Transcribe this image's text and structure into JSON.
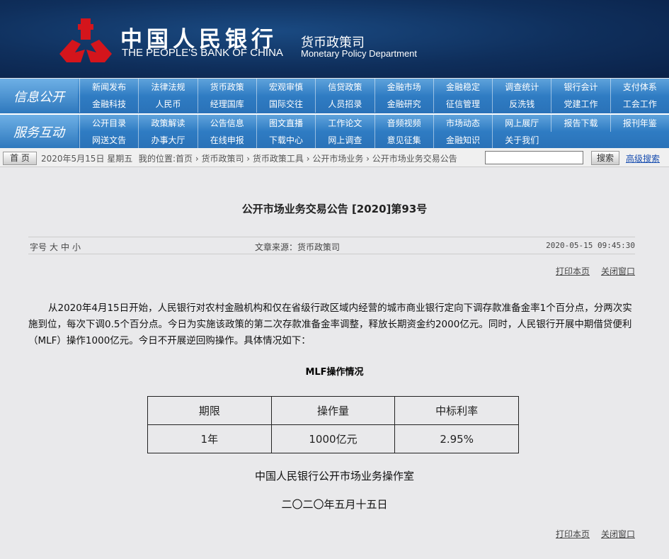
{
  "header": {
    "bank_cn": "中国人民银行",
    "bank_en": "THE PEOPLE'S BANK OF CHINA",
    "dept_cn": "货币政策司",
    "dept_en": "Monetary Policy Department"
  },
  "nav": {
    "band1_label": "信息公开",
    "band1_items": [
      "新闻发布",
      "法律法规",
      "货币政策",
      "宏观审慎",
      "信贷政策",
      "金融市场",
      "金融稳定",
      "调查统计",
      "银行会计",
      "支付体系",
      "金融科技",
      "人民币",
      "经理国库",
      "国际交往",
      "人员招录",
      "金融研究",
      "征信管理",
      "反洗钱",
      "党建工作",
      "工会工作"
    ],
    "band2_label": "服务互动",
    "band2_items": [
      "公开目录",
      "政策解读",
      "公告信息",
      "图文直播",
      "工作论文",
      "音频视频",
      "市场动态",
      "网上展厅",
      "报告下载",
      "报刊年鉴",
      "网送文告",
      "办事大厅",
      "在线申报",
      "下载中心",
      "网上调查",
      "意见征集",
      "金融知识",
      "关于我们"
    ]
  },
  "crumb": {
    "home": "首 页",
    "date": "2020年5月15日 星期五 ｜",
    "location": "我的位置:首页 › 货币政策司 › 货币政策工具 › 公开市场业务 › 公开市场业务交易公告",
    "search_value": "",
    "search_btn": "搜索",
    "advanced": "高级搜索"
  },
  "article": {
    "title": "公开市场业务交易公告 [2020]第93号",
    "font_label": "字号",
    "font_large": "大",
    "font_mid": "中",
    "font_small": "小",
    "source": "文章来源：货币政策司",
    "time": "2020-05-15 09:45:30",
    "print": "打印本页",
    "close": "关闭窗口",
    "paragraph": "从2020年4月15日开始，人民银行对农村金融机构和仅在省级行政区域内经营的城市商业银行定向下调存款准备金率1个百分点，分两次实施到位，每次下调0.5个百分点。今日为实施该政策的第二次存款准备金率调整，释放长期资金约2000亿元。同时，人民银行开展中期借贷便利（MLF）操作1000亿元。今日不开展逆回购操作。具体情况如下：",
    "table_title": "MLF操作情况",
    "table": {
      "headers": [
        "期限",
        "操作量",
        "中标利率"
      ],
      "rows": [
        [
          "1年",
          "1000亿元",
          "2.95%"
        ]
      ]
    },
    "signature": "中国人民银行公开市场业务操作室",
    "date": "二〇二〇年五月十五日"
  }
}
